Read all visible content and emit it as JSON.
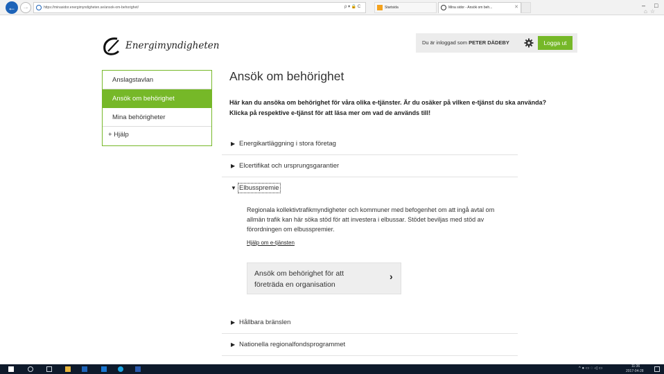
{
  "browser": {
    "url": "https://minasidor.energimyndigheten.se/ansok-om-behorighet/",
    "address_tools": "ρ ▾ 🔒 C",
    "tabs": [
      {
        "label": "Startsida"
      },
      {
        "label": "Mina sidor - Ansök om beh..."
      }
    ],
    "colors": {
      "back_button": "#1d63b8"
    }
  },
  "header": {
    "logo_text": "Energimyndigheten",
    "login_prefix": "Du är inloggad som",
    "user_name": "PETER DÄDEBY",
    "logout_label": "Logga ut"
  },
  "sidebar": {
    "items": [
      {
        "label": "Anslagstavlan",
        "active": false
      },
      {
        "label": "Ansök om behörighet",
        "active": true
      },
      {
        "label": "Mina behörigheter",
        "active": false
      },
      {
        "label": "+ Hjälp",
        "active": false
      }
    ]
  },
  "main": {
    "title": "Ansök om behörighet",
    "intro": "Här kan du ansöka om behörighet för våra olika e-tjänster. Är du osäker på vilken e-tjänst du ska använda? Klicka på respektive e-tjänst för att läsa mer om vad de används till!",
    "services": [
      {
        "label": "Energikartläggning i stora företag",
        "expanded": false
      },
      {
        "label": "Elcertifikat och ursprungsgarantier",
        "expanded": false
      },
      {
        "label": "Elbusspremie",
        "expanded": true
      },
      {
        "label": "Hållbara bränslen",
        "expanded": false
      },
      {
        "label": "Nationella regionalfondsprogrammet",
        "expanded": false
      }
    ],
    "expanded_service": {
      "description": "Regionala kollektivtrafikmyndigheter och kommuner med befogenhet om att ingå avtal om allmän trafik kan här söka stöd för att investera i elbussar. Stödet beviljas med stöd av förordningen om elbusspremier.",
      "help_link": "Hjälp om e-tjänsten",
      "apply_button": "Ansök om behörighet för att företräda en organisation"
    }
  },
  "taskbar": {
    "time": "11:36",
    "date": "2017-04-28"
  },
  "colors": {
    "accent": "#76b828",
    "header_box": "#ececec",
    "taskbar": "#0e1a2b"
  }
}
